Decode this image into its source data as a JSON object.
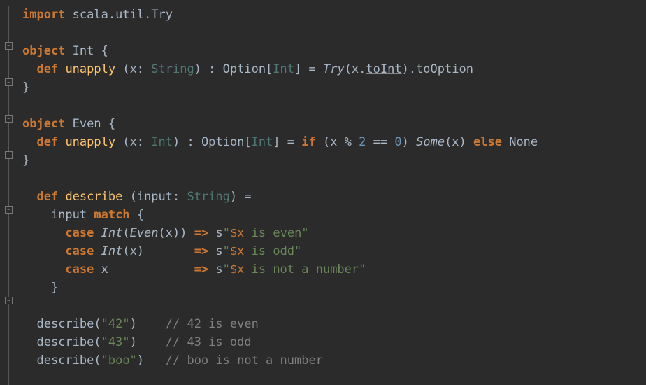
{
  "code": {
    "line1_import": "import",
    "line1_pkg": " scala.util.Try",
    "line3_object": "object",
    "line3_name": " Int ",
    "line3_brace": "{",
    "line4_def": "def",
    "line4_method": " unapply ",
    "line4_params": "(x: ",
    "line4_ptype": "String",
    "line4_after": ") : Option[",
    "line4_rtype": "Int",
    "line4_close": "] = ",
    "line4_try": "Try",
    "line4_call": "(x.",
    "line4_toint": "toInt",
    "line4_end": ").toOption",
    "line5_brace": "}",
    "line7_object": "object",
    "line7_name": " Even ",
    "line7_brace": "{",
    "line8_def": "def",
    "line8_method": " unapply ",
    "line8_params": "(x: ",
    "line8_ptype": "Int",
    "line8_after": ") : Option[",
    "line8_rtype": "Int",
    "line8_close": "] = ",
    "line8_if": "if",
    "line8_cond1": " (x % ",
    "line8_two": "2",
    "line8_eq": " == ",
    "line8_zero": "0",
    "line8_cond2": ") ",
    "line8_some": "Some",
    "line8_somex": "(x) ",
    "line8_else": "else",
    "line8_none": " None",
    "line9_brace": "}",
    "line11_def": "def",
    "line11_method": " describe ",
    "line11_params": "(input: ",
    "line11_ptype": "String",
    "line11_close": ") =",
    "line12_input": "    input ",
    "line12_match": "match",
    "line12_brace": " {",
    "line13_case": "case",
    "line13_pat": " Int",
    "line13_pat2": "(",
    "line13_even": "Even",
    "line13_pat3": "(x)) ",
    "line13_arrow": "=>",
    "line13_s": " s",
    "line13_q1": "\"",
    "line13_dx": "$x",
    "line13_rest": " is even",
    "line13_q2": "\"",
    "line14_case": "case",
    "line14_pat": " Int",
    "line14_pat2": "(x)       ",
    "line14_arrow": "=>",
    "line14_s": " s",
    "line14_q1": "\"",
    "line14_dx": "$x",
    "line14_rest": " is odd",
    "line14_q2": "\"",
    "line15_case": "case",
    "line15_pat": " x            ",
    "line15_arrow": "=>",
    "line15_s": " s",
    "line15_q1": "\"",
    "line15_dx": "$x",
    "line15_rest": " is not a number",
    "line15_q2": "\"",
    "line16_brace": "    }",
    "line18_call": "describe(",
    "line18_arg": "\"42\"",
    "line18_close": ")    ",
    "line18_comment": "// 42 is even",
    "line19_call": "describe(",
    "line19_arg": "\"43\"",
    "line19_close": ")    ",
    "line19_comment": "// 43 is odd",
    "line20_call": "describe(",
    "line20_arg": "\"boo\"",
    "line20_close": ")   ",
    "line20_comment": "// boo is not a number"
  }
}
